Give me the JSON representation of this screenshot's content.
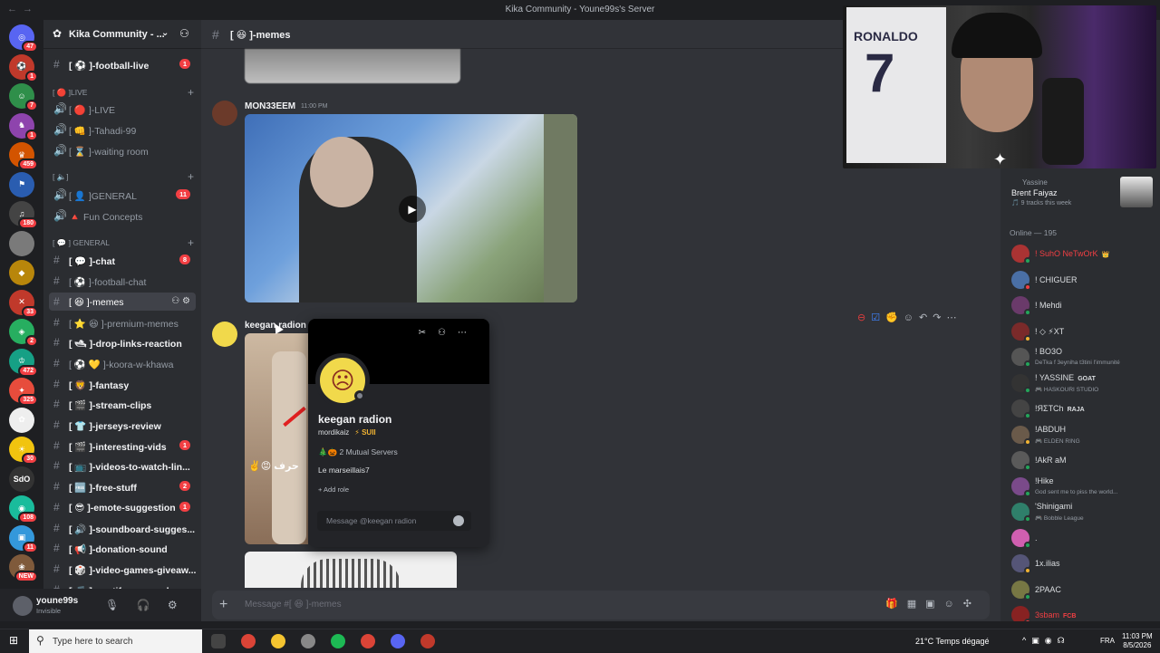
{
  "window": {
    "title": "Kika Community - Youne99s's Server"
  },
  "rail": {
    "servers": [
      {
        "label": "◎",
        "badge": "47"
      },
      {
        "label": "⚽",
        "badge": "1"
      },
      {
        "label": "☺",
        "badge": "7"
      },
      {
        "label": "♞",
        "badge": "1"
      },
      {
        "label": "♛",
        "badge": "459"
      },
      {
        "label": "⚑",
        "badge": ""
      },
      {
        "label": "♫",
        "badge": "180"
      },
      {
        "label": "",
        "badge": ""
      },
      {
        "label": "◆",
        "badge": ""
      },
      {
        "label": "✕",
        "badge": "33"
      },
      {
        "label": "◈",
        "badge": "2"
      },
      {
        "label": "♔",
        "badge": "472"
      },
      {
        "label": "✦",
        "badge": "325"
      },
      {
        "label": "✿",
        "badge": ""
      },
      {
        "label": "☀",
        "badge": "30"
      },
      {
        "label": "SdO",
        "badge": ""
      },
      {
        "label": "◉",
        "badge": "108"
      },
      {
        "label": "▣",
        "badge": "11"
      },
      {
        "label": "❀",
        "badge": "NEW"
      }
    ]
  },
  "sidebar": {
    "server_name": "Kika Community - ...",
    "categories": {
      "live": "[ 🔴 ]LIVE",
      "voice": "[ 🔈]",
      "general": "[ 💬 ] GENERAL"
    },
    "channels": [
      {
        "label": "[ ⚽ ]-football-live",
        "count": "1",
        "unread": true
      },
      {
        "label": "[ 🔴 ]-LIVE",
        "count": "",
        "unread": false
      },
      {
        "label": "[ 👊 ]-Tahadi-99",
        "count": "",
        "unread": false
      },
      {
        "label": "[ ⌛ ]-waiting room",
        "count": "",
        "unread": false
      },
      {
        "label": "[ 👤 ]GENERAL",
        "count": "11",
        "unread": false
      },
      {
        "label": "🔺 Fun Concepts",
        "count": "",
        "unread": false
      },
      {
        "label": "[ 💬 ]-chat",
        "count": "8",
        "unread": true
      },
      {
        "label": "[ ⚽ ]-football-chat",
        "count": "",
        "unread": false
      },
      {
        "label": "[ 😆 ]-memes",
        "count": "",
        "unread": false
      },
      {
        "label": "[ ⭐ 😆 ]-premium-memes",
        "count": "",
        "unread": false
      },
      {
        "label": "[ 🛥 ]-drop-links-reaction",
        "count": "",
        "unread": true
      },
      {
        "label": "[ ⚽ 💛 ]-koora-w-khawa",
        "count": "",
        "unread": false
      },
      {
        "label": "[ 🦁 ]-fantasy",
        "count": "",
        "unread": true
      },
      {
        "label": "[ 🎬 ]-stream-clips",
        "count": "",
        "unread": true
      },
      {
        "label": "[ 👕 ]-jerseys-review",
        "count": "",
        "unread": true
      },
      {
        "label": "[ 🎬 ]-interesting-vids",
        "count": "1",
        "unread": true
      },
      {
        "label": "[ 📺 ]-videos-to-watch-lin...",
        "count": "",
        "unread": true
      },
      {
        "label": "[ 🆓 ]-free-stuff",
        "count": "2",
        "unread": true
      },
      {
        "label": "[ 😎 ]-emote-suggestion",
        "count": "1",
        "unread": true
      },
      {
        "label": "[ 🔊 ]-soundboard-sugges...",
        "count": "",
        "unread": true
      },
      {
        "label": "[ 📢 ]-donation-sound",
        "count": "",
        "unread": true
      },
      {
        "label": "[ 🎲 ]-video-games-giveaw...",
        "count": "",
        "unread": true
      },
      {
        "label": "[ 🎵 ]-spotify-wrapped",
        "count": "",
        "unread": true
      }
    ]
  },
  "user": {
    "name": "youne99s",
    "status": "Invisible"
  },
  "chat": {
    "channel": "[ 😆 ]-memes",
    "messages": [
      {
        "author": "MON33EEM",
        "time": "11:00 PM"
      },
      {
        "author": "keegan radion",
        "time": ""
      }
    ],
    "composer_placeholder": "Message #[ 😆 ]-memes",
    "image_caption": "✌️😡 حرف"
  },
  "popup": {
    "display_name": "keegan radion",
    "username": "mordikaiz",
    "tag": "⚡ SUII",
    "mutual": "🎄🎃 2 Mutual Servers",
    "bio": "Le marseillais7",
    "add_role": "+ Add role",
    "message_placeholder": "Message @keegan radion"
  },
  "webcam": {
    "jersey_name": "RONALDO",
    "jersey_number": "7"
  },
  "members": {
    "now_playing": {
      "title": "Yassine",
      "artist": "Brent Faiyaz",
      "sub": "🎵 9 tracks this week"
    },
    "online_header": "Online — 195",
    "list": [
      {
        "name": "! SuhO NeTwOrK",
        "sub": "",
        "color": "#f23f43",
        "badge": "👑"
      },
      {
        "name": "! CHIGUER",
        "sub": "",
        "color": "#dbdee1",
        "badge": ""
      },
      {
        "name": "! Mehdi",
        "sub": "",
        "color": "#dbdee1",
        "badge": ""
      },
      {
        "name": "! ◇ ⚡XT",
        "sub": "",
        "color": "#dbdee1",
        "badge": ""
      },
      {
        "name": "! BO3O",
        "sub": "DeTka f 3eyniha t3tini l'immunité",
        "color": "#dbdee1",
        "badge": ""
      },
      {
        "name": "! YASSINE",
        "sub": "🎮 HASKOURI STUDIO",
        "color": "#dbdee1",
        "badge": "GOAT"
      },
      {
        "name": "!ЯΣTCh",
        "sub": "",
        "color": "#dbdee1",
        "badge": "RAJA"
      },
      {
        "name": "!ABDUH",
        "sub": "🎮 ELDEN RING",
        "color": "#dbdee1",
        "badge": ""
      },
      {
        "name": "!AkR aM",
        "sub": "",
        "color": "#dbdee1",
        "badge": ""
      },
      {
        "name": "!Hike",
        "sub": "God sent me to piss the world...",
        "color": "#dbdee1",
        "badge": ""
      },
      {
        "name": "'Shinigami",
        "sub": "🎮 Bobble League",
        "color": "#dbdee1",
        "badge": ""
      },
      {
        "name": ".",
        "sub": "",
        "color": "#dbdee1",
        "badge": ""
      },
      {
        "name": "1x.ilias",
        "sub": "",
        "color": "#dbdee1",
        "badge": ""
      },
      {
        "name": "2PAAC",
        "sub": "",
        "color": "#dbdee1",
        "badge": ""
      },
      {
        "name": "3sbam",
        "sub": "",
        "color": "#f23f43",
        "badge": "FCB"
      }
    ]
  },
  "taskbar": {
    "search_placeholder": "Type here to search",
    "weather": "21°C  Temps dégagé",
    "language": "FRA",
    "time": "11:03 PM",
    "date": "8/5/2026"
  },
  "colors": {
    "accent": "#5865f2",
    "danger": "#f23f43",
    "online": "#23a55a"
  }
}
